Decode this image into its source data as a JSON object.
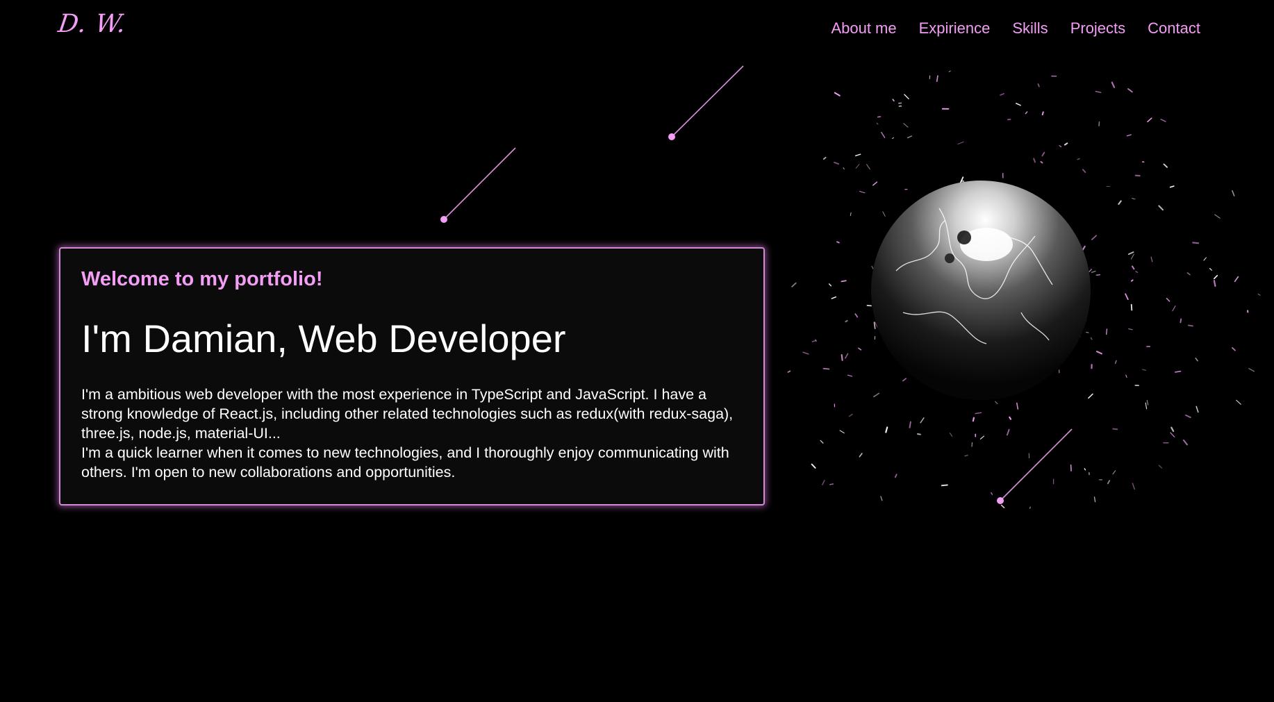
{
  "header": {
    "logo": "D. W.",
    "nav": [
      {
        "label": "About me"
      },
      {
        "label": "Expirience"
      },
      {
        "label": "Skills"
      },
      {
        "label": "Projects"
      },
      {
        "label": "Contact"
      }
    ]
  },
  "hero": {
    "subtitle": "Welcome to my portfolio!",
    "title": "I'm Damian, Web Developer",
    "paragraph_1": "I'm a ambitious web developer with the most experience in TypeScript and JavaScript. I have a strong knowledge of React.js, including other related technologies such as redux(with redux-saga), three.js, node.js, material-UI...",
    "paragraph_2": "I'm a quick learner when it comes to new technologies, and I thoroughly enjoy communicating with others. I'm open to new collaborations and opportunities."
  },
  "scene": {
    "globe_icon": "globe-icon",
    "star_icon": "shooting-star-icon"
  },
  "colors": {
    "accent": "#f39ef5",
    "background": "#000000",
    "card_background": "#0b0b0c",
    "card_border": "#d58ad8"
  }
}
